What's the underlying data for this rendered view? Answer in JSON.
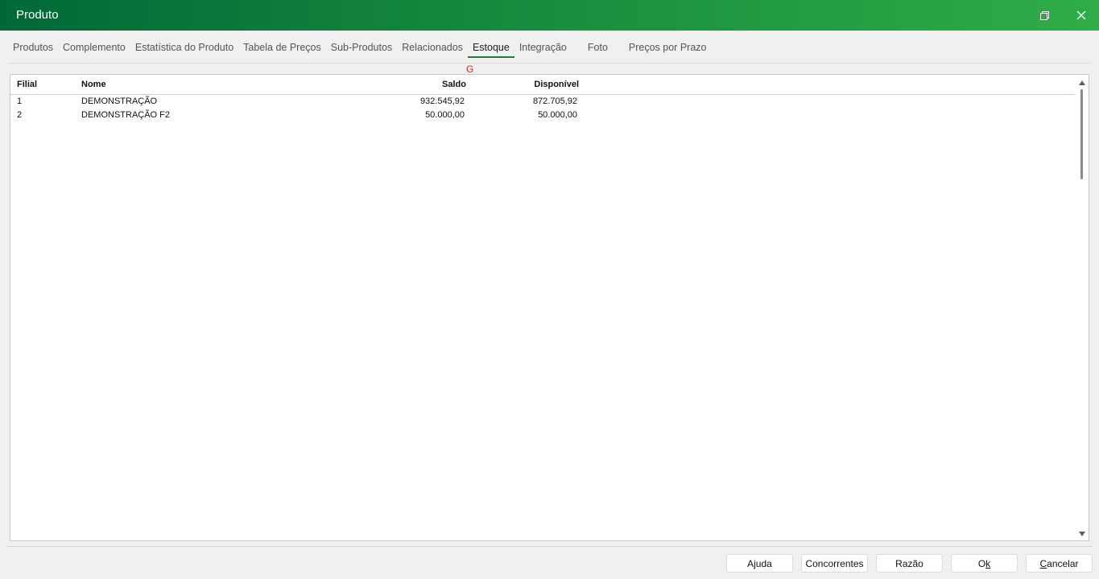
{
  "window": {
    "title": "Produto",
    "accent_gradient": [
      "#006838",
      "#2fad47"
    ],
    "controls": {
      "restore_icon": "restore-icon",
      "close_icon": "close-icon"
    }
  },
  "tabs": [
    {
      "label": "Produtos",
      "active": false
    },
    {
      "label": "Complemento",
      "active": false
    },
    {
      "label": "Estatística do Produto",
      "active": false
    },
    {
      "label": "Tabela de Preços",
      "active": false
    },
    {
      "label": "Sub-Produtos",
      "active": false
    },
    {
      "label": "Relacionados",
      "active": false
    },
    {
      "label": "Estoque",
      "active": true
    },
    {
      "label": "Integração",
      "active": false
    },
    {
      "label": "Foto",
      "active": false
    },
    {
      "label": "Preços por Prazo",
      "active": false
    }
  ],
  "shortcut_hint": "G",
  "grid": {
    "columns": {
      "filial": "Filial",
      "nome": "Nome",
      "saldo": "Saldo",
      "disponivel": "Disponível"
    },
    "rows": [
      {
        "filial": "1",
        "nome": "DEMONSTRAÇÃO",
        "saldo": "932.545,92",
        "disponivel": "872.705,92"
      },
      {
        "filial": "2",
        "nome": "DEMONSTRAÇÃO F2",
        "saldo": "50.000,00",
        "disponivel": "50.000,00"
      }
    ]
  },
  "footer": {
    "ajuda": "Ajuda",
    "concorrentes": "Concorrentes",
    "razao": "Razão",
    "ok_prefix": "O",
    "ok_accel": "k",
    "cancelar_accel": "C",
    "cancelar_rest": "ancelar"
  }
}
